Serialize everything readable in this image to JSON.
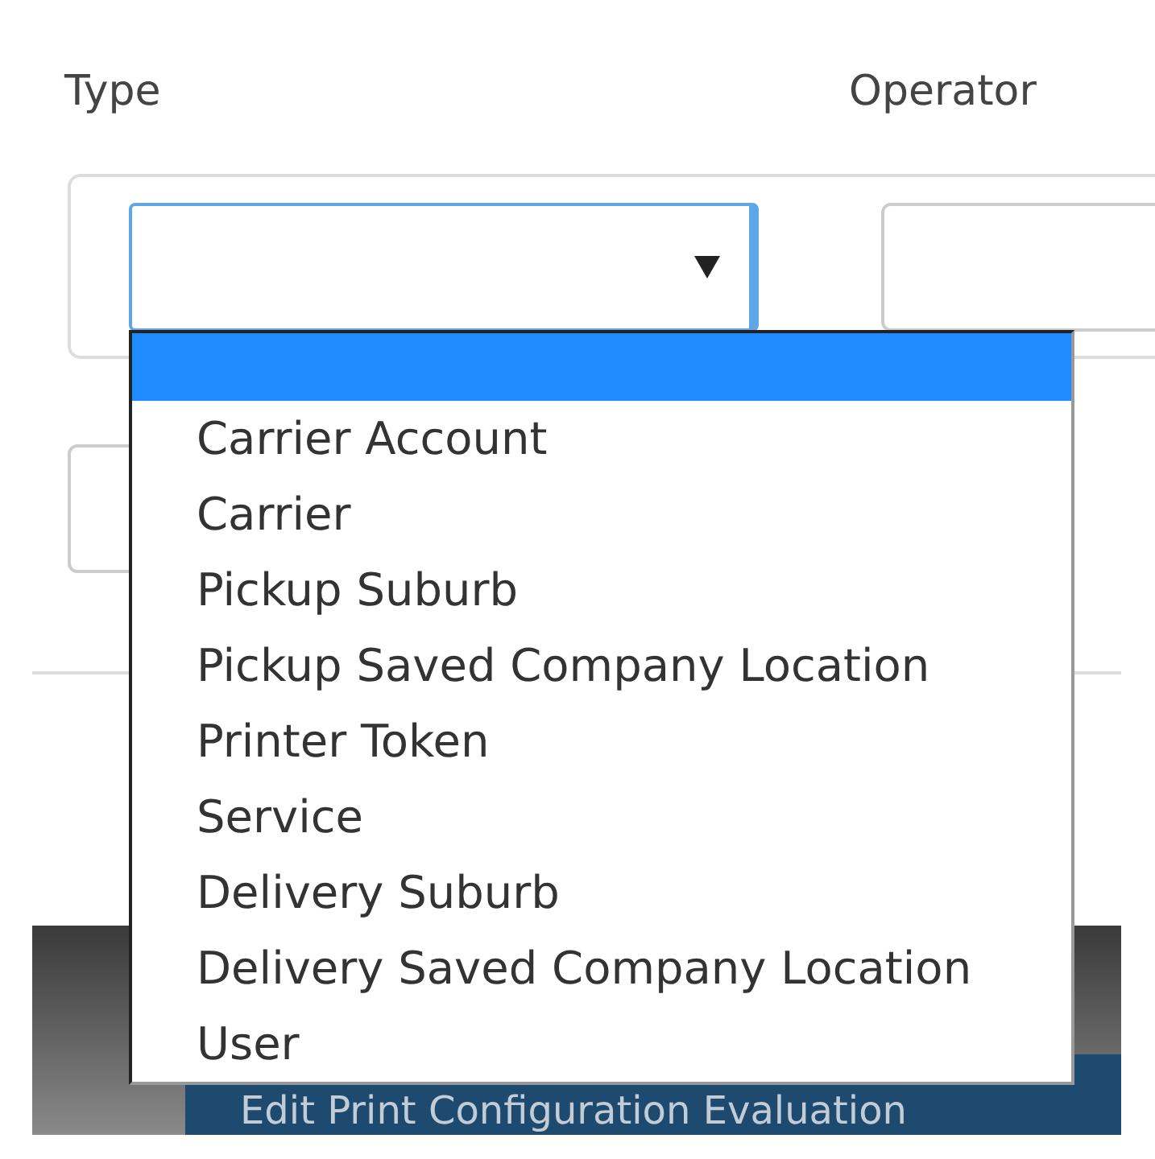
{
  "labels": {
    "type": "Type",
    "operator": "Operator"
  },
  "type_select": {
    "expanded": true
  },
  "dropdown": {
    "blank_option": {
      "selected": true
    },
    "options": [
      {
        "label": "Carrier Account",
        "selected": false
      },
      {
        "label": "Carrier",
        "selected": false
      },
      {
        "label": "Pickup Suburb",
        "selected": false
      },
      {
        "label": "Pickup Saved Company Location",
        "selected": false
      },
      {
        "label": "Printer Token",
        "selected": false
      },
      {
        "label": "Service",
        "selected": false
      },
      {
        "label": "Delivery Suburb",
        "selected": false
      },
      {
        "label": "Delivery Saved Company Location",
        "selected": false
      },
      {
        "label": "User",
        "selected": false
      }
    ]
  },
  "background_window": {
    "title": "Edit Print Configuration Evaluation"
  }
}
